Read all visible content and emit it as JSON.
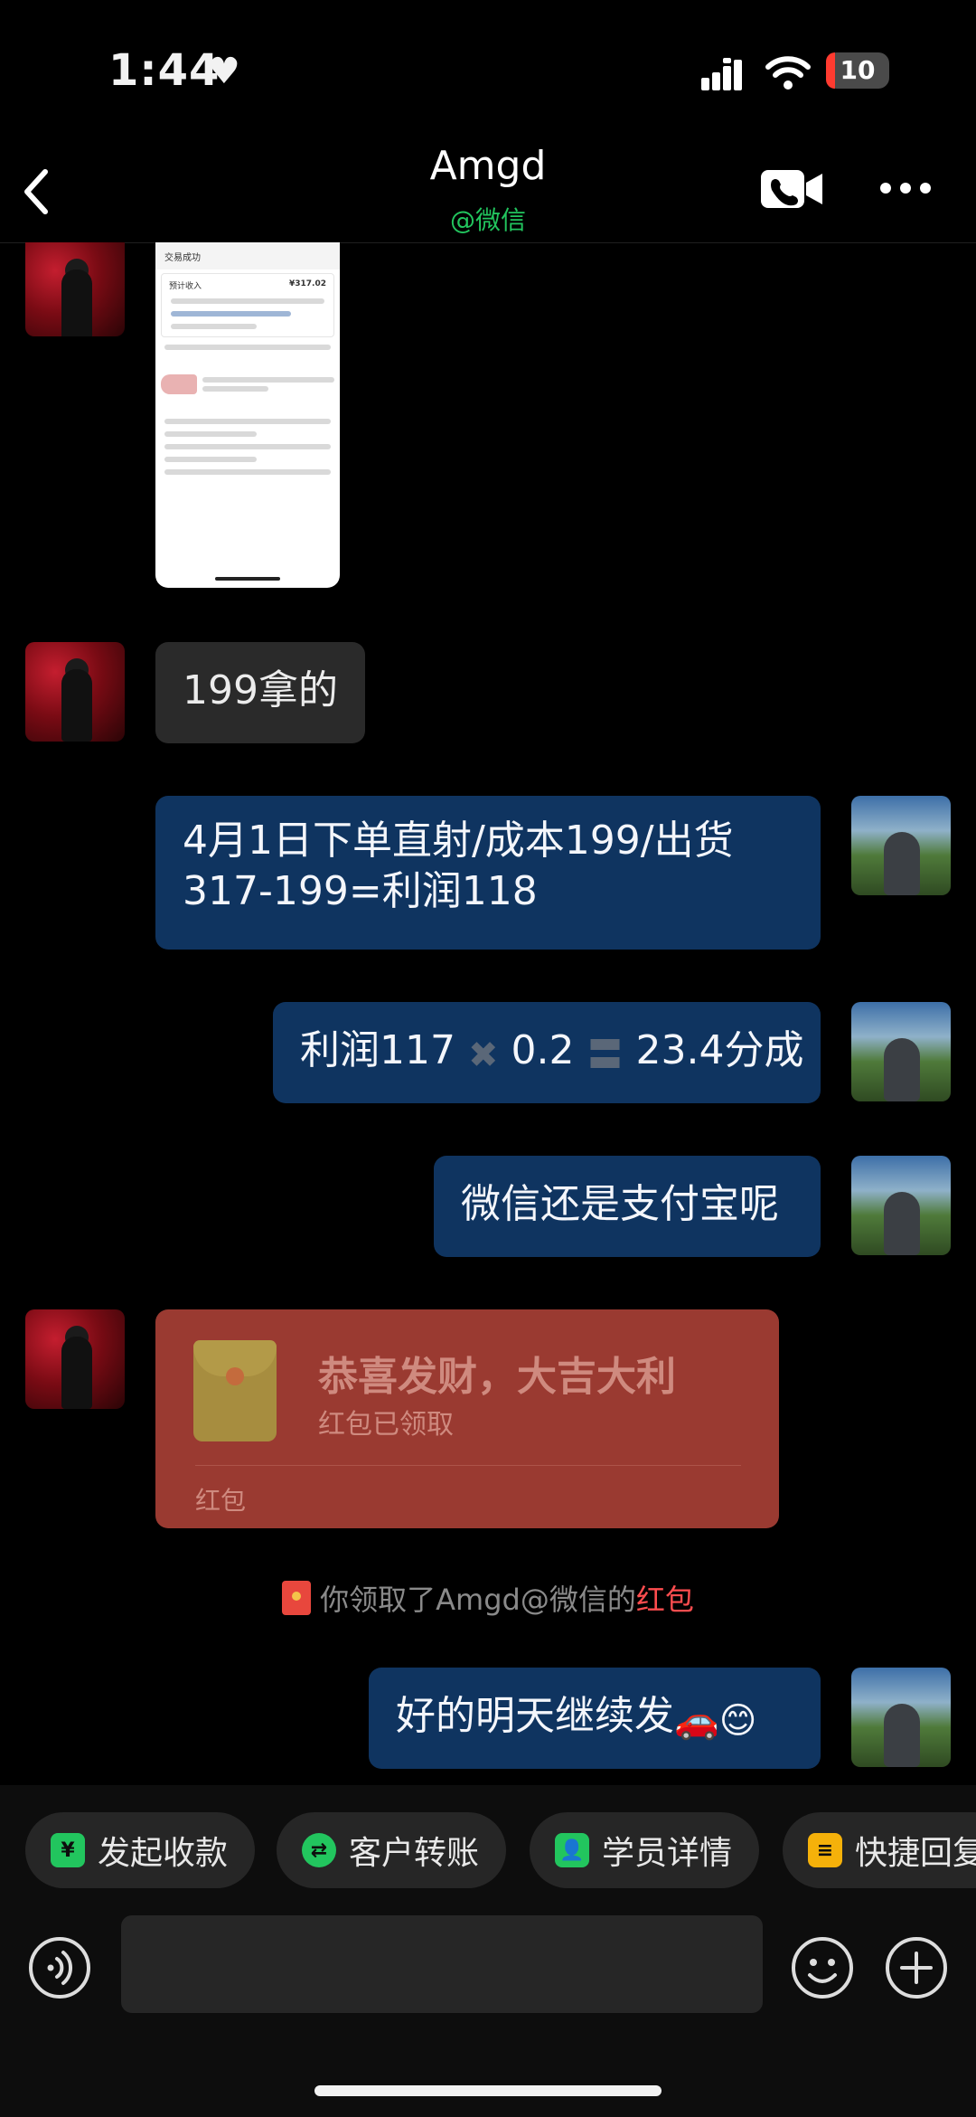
{
  "status": {
    "time": "1:44",
    "battery": "10"
  },
  "nav": {
    "title": "Amgd",
    "subtitle": "@微信"
  },
  "messages": {
    "m1": "199拿的",
    "m2": "4月1日下单直射/成本199/出货317-199=利润118",
    "m3_a": "利润117",
    "m3_b": "0.2",
    "m3_c": "23.4分成",
    "m4": "微信还是支付宝呢",
    "m6_text": "好的明天继续发",
    "m6_emoji": "🚗😊"
  },
  "screenshot": {
    "header": "交易成功",
    "income_label": "预计收入",
    "income_value": "¥317.02"
  },
  "red_packet": {
    "title": "恭喜发财，大吉大利",
    "status": "红包已领取",
    "label": "红包"
  },
  "system_notice": {
    "prefix": "你领取了Amgd@微信的",
    "highlight": "红包"
  },
  "quick_actions": [
    {
      "label": "发起收款",
      "icon": "yen-shield-icon",
      "color": "#22c55e"
    },
    {
      "label": "客户转账",
      "icon": "transfer-icon",
      "color": "#22c55e"
    },
    {
      "label": "学员详情",
      "icon": "user-card-icon",
      "color": "#22c55e"
    },
    {
      "label": "快捷回复",
      "icon": "quick-reply-icon",
      "color": "#f5b10a"
    }
  ],
  "colors": {
    "accent_green": "#22c55e",
    "bubble_me": "#0f3460",
    "bubble_other": "#2a2a2a",
    "red_packet": "#9a3a31",
    "highlight_red": "#ff4d4f"
  }
}
